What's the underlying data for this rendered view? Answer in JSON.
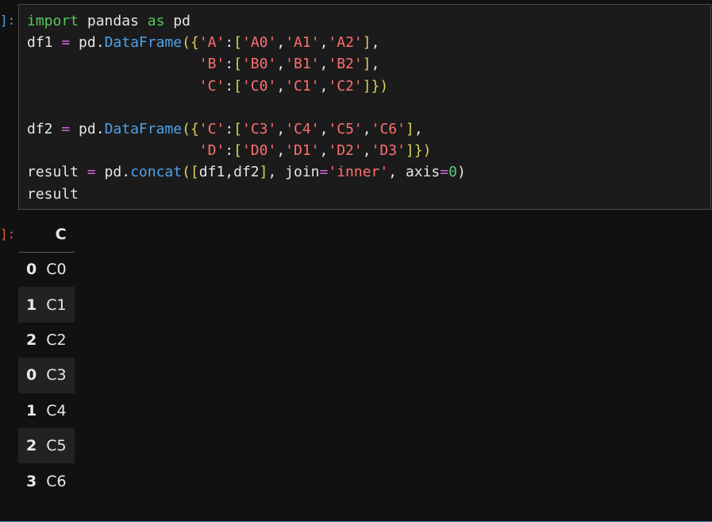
{
  "input_prompt": "]:",
  "output_prompt": "]:",
  "code_lines": [
    [
      {
        "t": "import",
        "c": "kw"
      },
      {
        "t": " pandas "
      },
      {
        "t": "as",
        "c": "kw"
      },
      {
        "t": " pd"
      }
    ],
    [
      {
        "t": "df1 "
      },
      {
        "t": "=",
        "c": "op"
      },
      {
        "t": " pd."
      },
      {
        "t": "DataFrame",
        "c": "fn"
      },
      {
        "t": "({",
        "c": "br"
      },
      {
        "t": "'A'",
        "c": "str"
      },
      {
        "t": ":"
      },
      {
        "t": "[",
        "c": "br"
      },
      {
        "t": "'A0'",
        "c": "str"
      },
      {
        "t": ","
      },
      {
        "t": "'A1'",
        "c": "str"
      },
      {
        "t": ","
      },
      {
        "t": "'A2'",
        "c": "str"
      },
      {
        "t": "]",
        "c": "br"
      },
      {
        "t": ","
      }
    ],
    [
      {
        "t": "                    "
      },
      {
        "t": "'B'",
        "c": "str"
      },
      {
        "t": ":"
      },
      {
        "t": "[",
        "c": "br"
      },
      {
        "t": "'B0'",
        "c": "str"
      },
      {
        "t": ","
      },
      {
        "t": "'B1'",
        "c": "str"
      },
      {
        "t": ","
      },
      {
        "t": "'B2'",
        "c": "str"
      },
      {
        "t": "]",
        "c": "br"
      },
      {
        "t": ","
      }
    ],
    [
      {
        "t": "                    "
      },
      {
        "t": "'C'",
        "c": "str"
      },
      {
        "t": ":"
      },
      {
        "t": "[",
        "c": "br"
      },
      {
        "t": "'C0'",
        "c": "str"
      },
      {
        "t": ","
      },
      {
        "t": "'C1'",
        "c": "str"
      },
      {
        "t": ","
      },
      {
        "t": "'C2'",
        "c": "str"
      },
      {
        "t": "]})",
        "c": "br"
      }
    ],
    [
      {
        "t": ""
      }
    ],
    [
      {
        "t": "df2 "
      },
      {
        "t": "=",
        "c": "op"
      },
      {
        "t": " pd."
      },
      {
        "t": "DataFrame",
        "c": "fn"
      },
      {
        "t": "({",
        "c": "br"
      },
      {
        "t": "'C'",
        "c": "str"
      },
      {
        "t": ":"
      },
      {
        "t": "[",
        "c": "br"
      },
      {
        "t": "'C3'",
        "c": "str"
      },
      {
        "t": ","
      },
      {
        "t": "'C4'",
        "c": "str"
      },
      {
        "t": ","
      },
      {
        "t": "'C5'",
        "c": "str"
      },
      {
        "t": ","
      },
      {
        "t": "'C6'",
        "c": "str"
      },
      {
        "t": "]",
        "c": "br"
      },
      {
        "t": ","
      }
    ],
    [
      {
        "t": "                    "
      },
      {
        "t": "'D'",
        "c": "str"
      },
      {
        "t": ":"
      },
      {
        "t": "[",
        "c": "br"
      },
      {
        "t": "'D0'",
        "c": "str"
      },
      {
        "t": ","
      },
      {
        "t": "'D1'",
        "c": "str"
      },
      {
        "t": ","
      },
      {
        "t": "'D2'",
        "c": "str"
      },
      {
        "t": ","
      },
      {
        "t": "'D3'",
        "c": "str"
      },
      {
        "t": "]})",
        "c": "br"
      }
    ],
    [
      {
        "t": "result "
      },
      {
        "t": "=",
        "c": "op"
      },
      {
        "t": " pd."
      },
      {
        "t": "concat",
        "c": "fn"
      },
      {
        "t": "([",
        "c": "br"
      },
      {
        "t": "df1,df2"
      },
      {
        "t": "]",
        "c": "br"
      },
      {
        "t": ", join"
      },
      {
        "t": "=",
        "c": "op"
      },
      {
        "t": "'inner'",
        "c": "str"
      },
      {
        "t": ", axis"
      },
      {
        "t": "=",
        "c": "op"
      },
      {
        "t": "0",
        "c": "num"
      },
      {
        "t": ")"
      }
    ],
    [
      {
        "t": "result"
      }
    ]
  ],
  "output_table": {
    "columns": [
      "C"
    ],
    "rows": [
      {
        "index": "0",
        "values": [
          "C0"
        ]
      },
      {
        "index": "1",
        "values": [
          "C1"
        ]
      },
      {
        "index": "2",
        "values": [
          "C2"
        ]
      },
      {
        "index": "0",
        "values": [
          "C3"
        ]
      },
      {
        "index": "1",
        "values": [
          "C4"
        ]
      },
      {
        "index": "2",
        "values": [
          "C5"
        ]
      },
      {
        "index": "3",
        "values": [
          "C6"
        ]
      }
    ]
  },
  "colors": {
    "background": "#111111",
    "cell_border": "#4a4a4a",
    "keyword": "#59c65c",
    "operator": "#d566d9",
    "function": "#4ea1e8",
    "string": "#ff6e6e",
    "bracket": "#d8d25c",
    "number": "#5ec77a",
    "input_prompt": "#4ea1e8",
    "output_prompt": "#e05a2e"
  }
}
